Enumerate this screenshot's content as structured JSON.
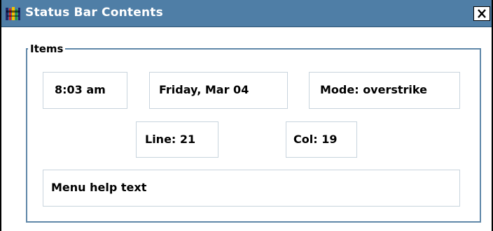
{
  "window": {
    "title": "Status Bar Contents",
    "icon": "application-icon",
    "close_icon": "close-icon"
  },
  "group": {
    "label": "Items"
  },
  "items": {
    "time": "8:03 am",
    "date": "Friday, Mar 04",
    "mode": "Mode: overstrike",
    "line": "Line: 21",
    "col": "Col: 19",
    "menu_help": "Menu help text"
  },
  "colors": {
    "titlebar": "#4f7ea6",
    "title_text": "#ffffff",
    "group_border": "#5f87a8",
    "item_border": "#c8d4dd"
  }
}
